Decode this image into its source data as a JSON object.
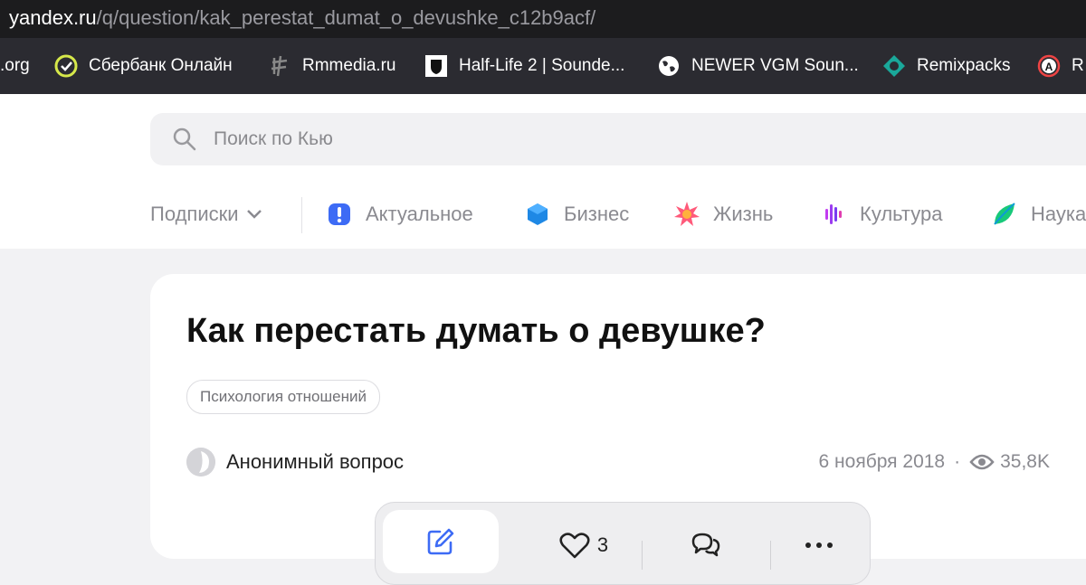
{
  "browser": {
    "url_domain": "yandex.ru",
    "url_path": "/q/question/kak_perestat_dumat_o_devushke_c12b9acf/"
  },
  "bookmarks": [
    {
      "label": ".org",
      "icon": "none"
    },
    {
      "label": "Сбербанк Онлайн",
      "icon": "sberbank-icon"
    },
    {
      "label": "Rmmedia.ru",
      "icon": "rmmedia-icon"
    },
    {
      "label": "Half-Life 2 | Sounde...",
      "icon": "shield-icon"
    },
    {
      "label": "NEWER VGM Soun...",
      "icon": "globe-icon"
    },
    {
      "label": "Remixpacks",
      "icon": "remixpacks-icon"
    },
    {
      "label": "R",
      "icon": "circle-a-icon"
    }
  ],
  "search": {
    "placeholder": "Поиск по Кью"
  },
  "nav": {
    "subscriptions_label": "Подписки",
    "categories": [
      {
        "label": "Актуальное",
        "icon": "exclamation-icon",
        "color": "#3d6bf5"
      },
      {
        "label": "Бизнес",
        "icon": "cube-icon",
        "color": "#1e88e5"
      },
      {
        "label": "Жизнь",
        "icon": "star-burst-icon",
        "color": "#ff4f8b"
      },
      {
        "label": "Культура",
        "icon": "wave-icon",
        "color": "#9c3cf0"
      },
      {
        "label": "Наука",
        "icon": "leaf-icon",
        "color": "#18c97a"
      }
    ]
  },
  "question": {
    "title": "Как перестать думать о девушке?",
    "tag": "Психология отношений",
    "author": "Анонимный вопрос",
    "date": "6 ноября 2018",
    "separator": "·",
    "views": "35,8K"
  },
  "actions": {
    "likes": "3"
  }
}
